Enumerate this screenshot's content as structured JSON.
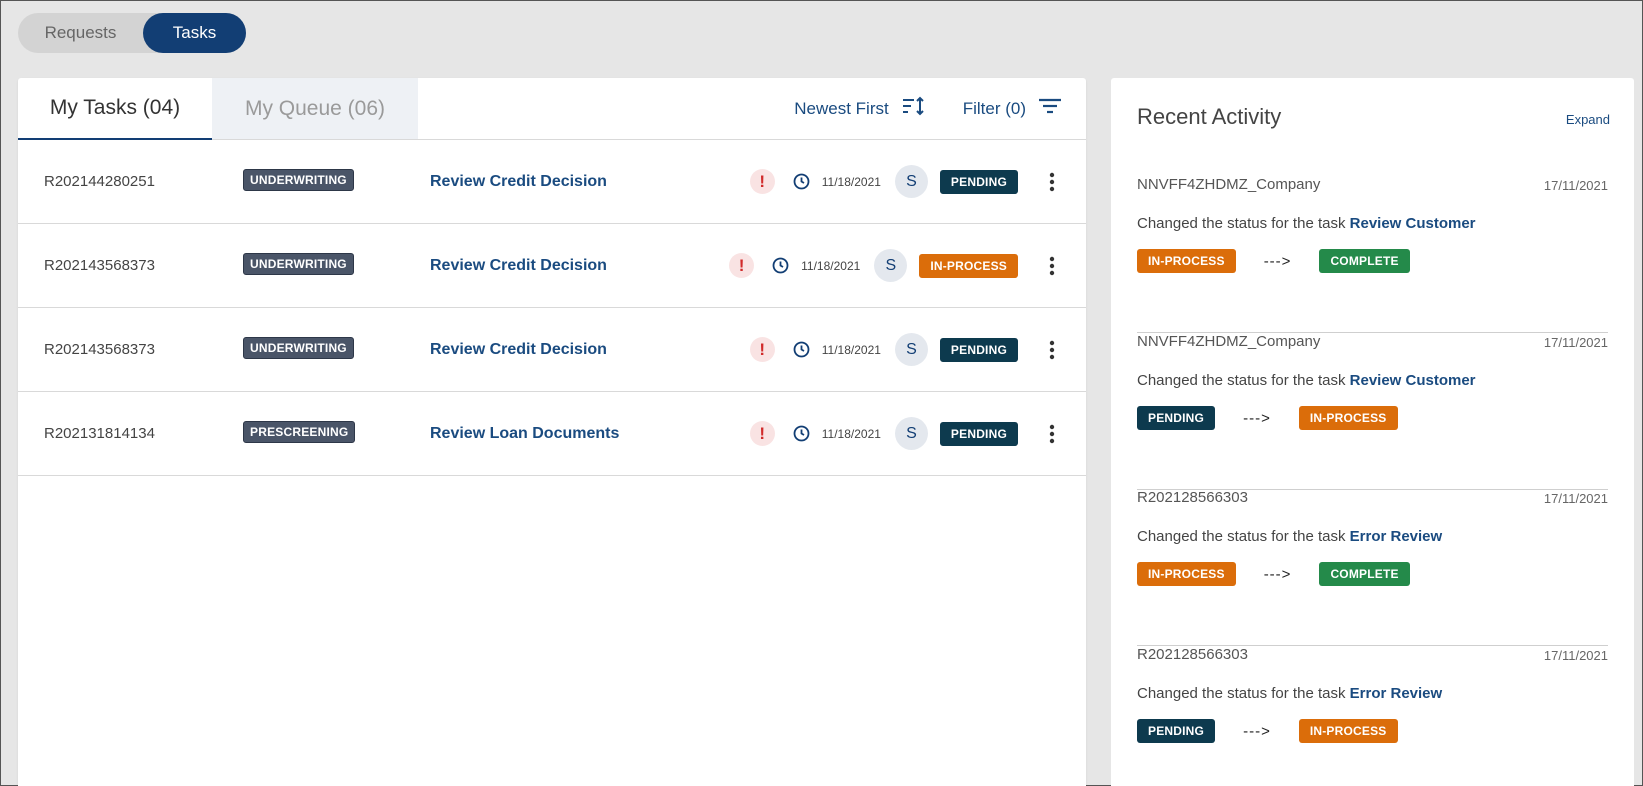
{
  "toggle": {
    "requests": "Requests",
    "tasks": "Tasks"
  },
  "tasks_panel": {
    "tab_my_tasks": "My Tasks (04)",
    "tab_my_queue": "My Queue (06)",
    "sort_label": "Newest First",
    "filter_label": "Filter (0)",
    "rows": [
      {
        "id": "R202144280251",
        "category": "UNDERWRITING",
        "task": "Review Credit Decision",
        "alert": "!",
        "date": "11/18/2021",
        "assignee": "S",
        "status": "PENDING"
      },
      {
        "id": "R202143568373",
        "category": "UNDERWRITING",
        "task": "Review Credit Decision",
        "alert": "!",
        "date": "11/18/2021",
        "assignee": "S",
        "status": "IN-PROCESS"
      },
      {
        "id": "R202143568373",
        "category": "UNDERWRITING",
        "task": "Review Credit Decision",
        "alert": "!",
        "date": "11/18/2021",
        "assignee": "S",
        "status": "PENDING"
      },
      {
        "id": "R202131814134",
        "category": "PRESCREENING",
        "task": "Review Loan Documents",
        "alert": "!",
        "date": "11/18/2021",
        "assignee": "S",
        "status": "PENDING"
      }
    ]
  },
  "activity": {
    "title": "Recent Activity",
    "expand": "Expand",
    "items": [
      {
        "who": "NNVFF4ZHDMZ_Company",
        "date": "17/11/2021",
        "text": "Changed the status for the task",
        "link": "Review Customer",
        "from": "IN-PROCESS",
        "to": "COMPLETE"
      },
      {
        "who": "NNVFF4ZHDMZ_Company",
        "date": "17/11/2021",
        "text": "Changed the status for the task",
        "link": "Review Customer",
        "from": "PENDING",
        "to": "IN-PROCESS"
      },
      {
        "who": "R202128566303",
        "date": "17/11/2021",
        "text": "Changed the status for the task",
        "link": "Error Review",
        "from": "IN-PROCESS",
        "to": "COMPLETE"
      },
      {
        "who": "R202128566303",
        "date": "17/11/2021",
        "text": "Changed the status for the task",
        "link": "Error Review",
        "from": "PENDING",
        "to": "IN-PROCESS"
      }
    ],
    "arrow": "--->"
  },
  "colors": {
    "primary": "#123e74",
    "pending": "#0d3a4e",
    "in_process": "#db6d0a",
    "complete": "#248a4a",
    "alert": "#d12b2b"
  },
  "icons": {
    "sort": "sort-icon",
    "filter": "filter-icon",
    "clock": "clock-icon",
    "alert": "alert-icon",
    "kebab": "kebab-menu-icon"
  }
}
